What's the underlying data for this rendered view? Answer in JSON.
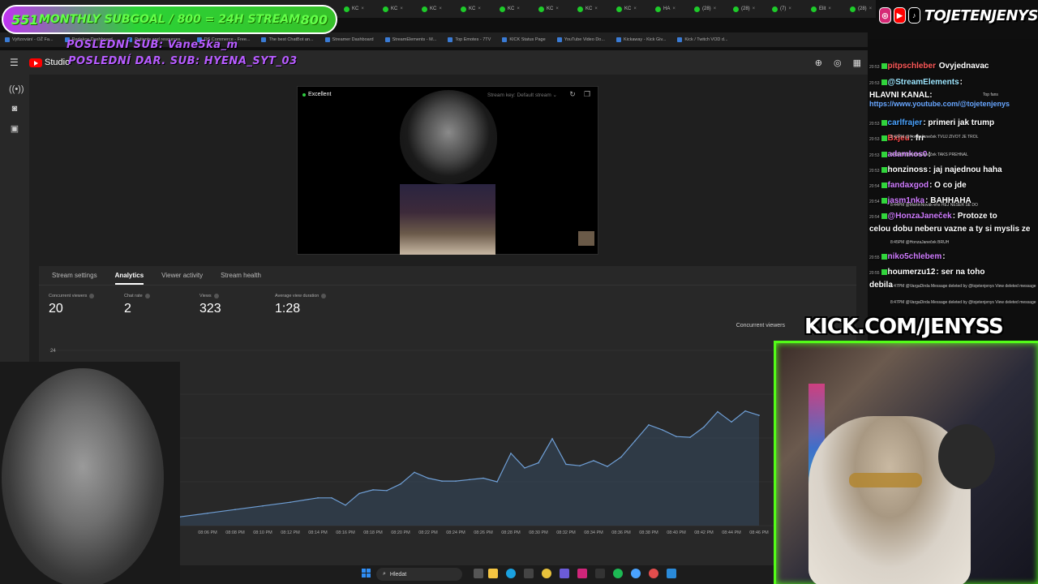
{
  "browser": {
    "tabs": [
      "KC",
      "KC",
      "KC",
      "KC",
      "KC",
      "KC",
      "KC",
      "KC",
      "HA",
      "(28)",
      "(28)",
      "(7)",
      "Elit",
      "(28)",
      "(57)"
    ],
    "bookmarks": [
      "Vyřizování - OŽ Fa...",
      "Redakce Dashboard...",
      "Patients and resources ...",
      "DS Commerce - Free...",
      "The best ChatBot an...",
      "Streamer Dashboard",
      "StreamElements - M...",
      "Top Emotes - 7TV",
      "KICK Status Page",
      "YouTube Video Do...",
      "Kickaway - Kick Giv...",
      "Kick / Twitch VOD d..."
    ]
  },
  "overlay": {
    "subgoal_left": "551",
    "subgoal_title": "MONTHLY SUBGOAL / 800 = 24H STREAM",
    "subgoal_right": "800",
    "last_sub": "POSLEDNÍ SUB: Vane5ka_m",
    "last_dar_sub": "POSLEDNÍ DAR. SUB: HYENA_SYT_03",
    "brand": "TOJETENJENYS",
    "kick_url": "KICK.COM/JENYSS"
  },
  "studio": {
    "title": "Studio",
    "preview": {
      "quality": "Excellent",
      "stream_key": "Stream key: Default stream"
    },
    "tabs": [
      "Stream settings",
      "Analytics",
      "Viewer activity",
      "Stream health"
    ],
    "active_tab": "Analytics",
    "stats": [
      {
        "label": "Concurrent viewers",
        "value": "20"
      },
      {
        "label": "Chat rate",
        "value": "2"
      },
      {
        "label": "Views",
        "value": "323"
      },
      {
        "label": "Average view duration",
        "value": "1:28"
      }
    ],
    "legend": "Concurrent viewers"
  },
  "chart_data": {
    "type": "area",
    "title": "",
    "ylabel": "",
    "xlabel": "",
    "ylim": [
      0,
      24
    ],
    "y_tick_labels": [
      "24"
    ],
    "x_tick_labels": [
      "08:06 PM",
      "08:08 PM",
      "08:10 PM",
      "08:12 PM",
      "08:14 PM",
      "08:16 PM",
      "08:18 PM",
      "08:20 PM",
      "08:22 PM",
      "08:24 PM",
      "08:26 PM",
      "08:28 PM",
      "08:30 PM",
      "08:32 PM",
      "08:34 PM",
      "08:36 PM",
      "08:38 PM",
      "08:40 PM",
      "08:42 PM",
      "08:44 PM",
      "08:46 PM"
    ],
    "series": [
      {
        "name": "Concurrent viewers",
        "x": [
          "08:04 PM",
          "08:06 PM",
          "08:08 PM",
          "08:10 PM",
          "08:12 PM",
          "08:14 PM",
          "08:15 PM",
          "08:16 PM",
          "08:17 PM",
          "08:18 PM",
          "08:19 PM",
          "08:20 PM",
          "08:21 PM",
          "08:22 PM",
          "08:23 PM",
          "08:24 PM",
          "08:25 PM",
          "08:26 PM",
          "08:27 PM",
          "08:28 PM",
          "08:29 PM",
          "08:30 PM",
          "08:31 PM",
          "08:32 PM",
          "08:33 PM",
          "08:34 PM",
          "08:35 PM",
          "08:36 PM",
          "08:37 PM",
          "08:38 PM",
          "08:39 PM",
          "08:40 PM",
          "08:41 PM",
          "08:42 PM",
          "08:43 PM",
          "08:44 PM",
          "08:45 PM",
          "08:46 PM"
        ],
        "values": [
          1.2,
          1.7,
          2.2,
          2.7,
          3.2,
          3.8,
          3.8,
          2.8,
          4.4,
          4.9,
          4.8,
          5.7,
          7.3,
          6.5,
          6.1,
          6.1,
          6.3,
          6.5,
          6.0,
          9.9,
          7.9,
          8.6,
          11.9,
          8.4,
          8.2,
          8.9,
          8.1,
          9.4,
          11.6,
          13.8,
          13.1,
          12.2,
          12.1,
          13.5,
          15.6,
          14.2,
          15.7,
          15.1
        ]
      }
    ],
    "grid": true
  },
  "chat": {
    "lines": [
      {
        "ts": "20:53",
        "name": "pitpschleber",
        "text": " Ovyjednavac",
        "color": "#ff5a5a"
      },
      {
        "ts": "20:53",
        "name": "@StreamElements",
        "text": ":",
        "color": "#9ee7ff"
      },
      {
        "ts": "",
        "name": "HLAVNÍ KANÁL:",
        "text": "",
        "color": "#ffffff"
      },
      {
        "ts": "20:53",
        "name": "carlfrajer",
        "text": ": primeri jak trump",
        "color": "#4aa3ff"
      },
      {
        "ts": "20:53",
        "name": "Bxjeu",
        "text": ": frr",
        "color": "#ff4a4a"
      },
      {
        "ts": "20:53",
        "name": "adamkos0",
        "text": ":",
        "color": "#d07cff"
      },
      {
        "ts": "20:53",
        "name": "honzinoss",
        "text": ": jaj najednou haha",
        "color": "#ffffff"
      },
      {
        "ts": "20:54",
        "name": "fandaxgod",
        "text": ": O co jde",
        "color": "#d07cff"
      },
      {
        "ts": "20:54",
        "name": "jasm1nka",
        "text": ": BAHHAHA",
        "color": "#d07cff"
      },
      {
        "ts": "20:54",
        "name": "@HonzaJaneček",
        "text": ": Protoze to",
        "color": "#d07cff"
      },
      {
        "ts": "",
        "name": "celou dobu neberu vazne a ty si myslis ze",
        "text": "",
        "color": "#ffffff"
      },
      {
        "ts": "20:55",
        "name": "niko5chlebem",
        "text": ":",
        "color": "#d07cff"
      },
      {
        "ts": "20:55",
        "name": "houmerzu12",
        "text": ": ser na toho",
        "color": "#ffffff"
      },
      {
        "ts": "",
        "name": "debila",
        "text": "",
        "color": "#ffffff"
      }
    ],
    "link": "https://www.youtube.com/@tojetenjenys",
    "small": [
      "8:43PM @HonzaJaneček TVUJ ZIVOT JE TROL",
      "8:43PM @HonzaJaneček TAKS PREHNAL",
      "8:44PM @MartinNovák-ehs HEJ NESER SE DO",
      "8:45PM @HonzaJaneček BRUH",
      "8:47PM @VargaDirda Message deleted by @tojetenjenys View deleted message",
      "8:47PM @VargaDirda Message deleted by @tojetenjenys View deleted message"
    ],
    "top_fans": "Top fans"
  },
  "taskbar": {
    "search": "Hledat"
  }
}
